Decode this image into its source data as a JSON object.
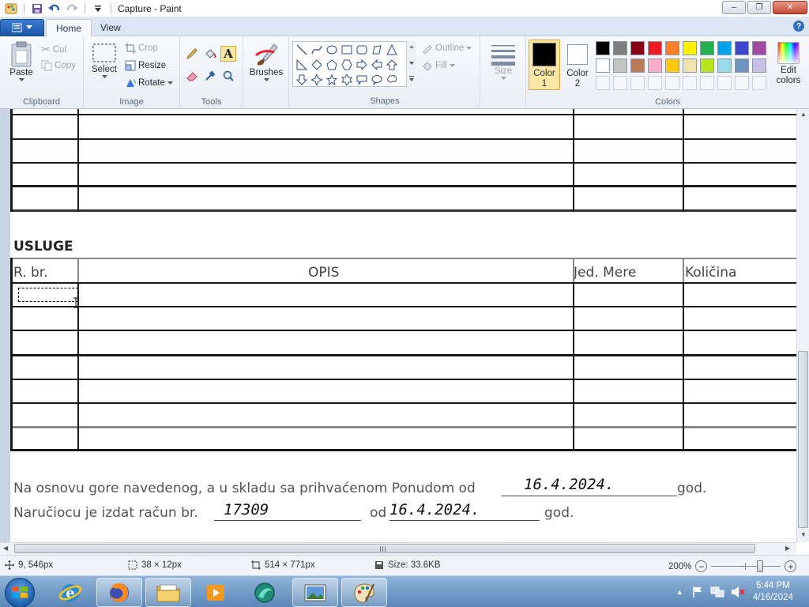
{
  "window": {
    "title": "Capture - Paint",
    "minimize_label": "–",
    "restore_label": "❐",
    "close_label": "✕"
  },
  "tabs": [
    {
      "label": "Home",
      "active": true
    },
    {
      "label": "View",
      "active": false
    }
  ],
  "help_label": "?",
  "ribbon": {
    "clipboard": {
      "paste": "Paste",
      "cut": "Cut",
      "copy": "Copy",
      "label": "Clipboard"
    },
    "image": {
      "select": "Select",
      "crop": "Crop",
      "resize": "Resize",
      "rotate": "Rotate",
      "label": "Image"
    },
    "tools": {
      "label": "Tools"
    },
    "brushes": {
      "label": "Brushes"
    },
    "shapes": {
      "outline": "Outline",
      "fill": "Fill",
      "label": "Shapes"
    },
    "size": {
      "label": "Size"
    },
    "color1": {
      "line1": "Color",
      "line2": "1"
    },
    "color2": {
      "line1": "Color",
      "line2": "2"
    },
    "edit_colors": {
      "line1": "Edit",
      "line2": "colors"
    },
    "colors_label": "Colors",
    "palette_row1": [
      "#000000",
      "#7f7f7f",
      "#880015",
      "#ed1c24",
      "#ff7f27",
      "#fff200",
      "#22b14c",
      "#00a2e8",
      "#3f48cc",
      "#a349a4"
    ],
    "palette_row2": [
      "#ffffff",
      "#c3c3c3",
      "#b97a57",
      "#ffaec9",
      "#ffc90e",
      "#efe4b0",
      "#b5e61d",
      "#99d9ea",
      "#7092be",
      "#c8bfe7"
    ]
  },
  "document": {
    "section_heading": "USLUGE",
    "col_rbr": "R. br.",
    "col_opis": "OPIS",
    "col_jed": "Jed. Mere",
    "col_kol": "Količina",
    "line1_text": "Na osnovu gore navedenog, a u skladu sa prihvaćenom Ponudom  od",
    "line1_date": "16.4.2024.",
    "line1_end": "god.",
    "line2_text": "Naručiocu je izdat račun br.",
    "line2_number": "17309",
    "line2_od": "od",
    "line2_date": "16.4.2024.",
    "line2_end": "god."
  },
  "status": {
    "position": "9, 546px",
    "selection_size": "38 × 12px",
    "image_size": "514 × 771px",
    "file_size": "Size: 33.6KB",
    "zoom": "200%"
  },
  "taskbar": {
    "apps": [
      "internet-explorer",
      "firefox",
      "file-explorer",
      "media-player",
      "browser-app",
      "photo-viewer",
      "paint"
    ],
    "time": "5:44 PM",
    "date": "4/16/2024"
  }
}
